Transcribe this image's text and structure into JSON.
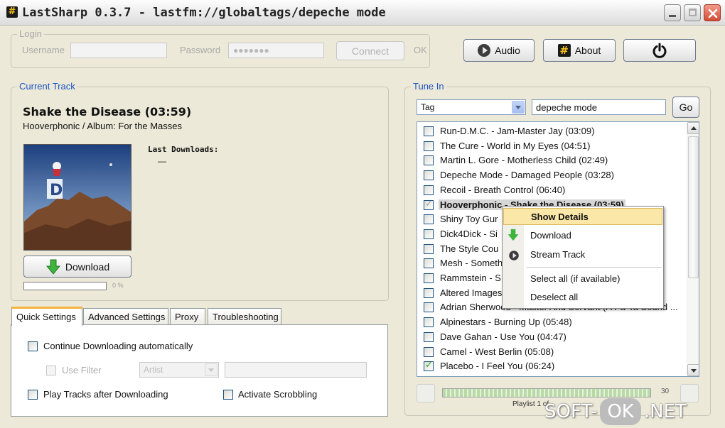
{
  "window": {
    "title": "LastSharp 0.3.7 - lastfm://globaltags/depeche mode",
    "app_icon": "#"
  },
  "login": {
    "legend": "Login",
    "username_label": "Username",
    "username_value": "",
    "password_label": "Password",
    "password_value": "●●●●●●●",
    "connect_label": "Connect",
    "status": "OK"
  },
  "toolbar": {
    "audio_label": "Audio",
    "about_label": "About",
    "power_icon": "power-icon"
  },
  "current_track": {
    "legend": "Current Track",
    "title": "Shake the Disease (03:59)",
    "subtitle": "Hooverphonic / Album: For the Masses",
    "last_downloads_label": "Last Downloads:",
    "last_downloads_value": "—",
    "download_label": "Download",
    "progress_pct": "0 %",
    "progress_value": 0
  },
  "tabs": [
    "Quick Settings",
    "Advanced Settings",
    "Proxy",
    "Troubleshooting"
  ],
  "quick_settings": {
    "continue_label": "Continue Downloading automatically",
    "use_filter_label": "Use Filter",
    "filter_select": "Artist",
    "play_tracks_label": "Play Tracks after Downloading",
    "scrobbling_label": "Activate Scrobbling"
  },
  "tune_in": {
    "legend": "Tune In",
    "type_select": "Tag",
    "query": "depeche mode",
    "go_label": "Go",
    "tracks": [
      {
        "text": "Run-D.M.C. - Jam-Master Jay (03:09)",
        "checked": false
      },
      {
        "text": "The Cure - World in My Eyes (04:51)",
        "checked": false
      },
      {
        "text": "Martin L. Gore - Motherless Child (02:49)",
        "checked": false
      },
      {
        "text": "Depeche Mode - Damaged People (03:28)",
        "checked": false
      },
      {
        "text": "Recoil - Breath Control (06:40)",
        "checked": false
      },
      {
        "text": "Hooverphonic - Shake the Disease (03:59)",
        "checked": true,
        "selected": true
      },
      {
        "text": "Shiny Toy Gur",
        "checked": false
      },
      {
        "text": "Dick4Dick - Si",
        "checked": false
      },
      {
        "text": "The Style Cou",
        "checked": false
      },
      {
        "text": "Mesh - Someth",
        "checked": false
      },
      {
        "text": "Rammstein - S",
        "checked": false
      },
      {
        "text": "Altered Images",
        "checked": false
      },
      {
        "text": "Adrian Sherwood - Master And Servant (A Pa-Ta Sound ...",
        "checked": false
      },
      {
        "text": "Alpinestars - Burning Up (05:48)",
        "checked": false
      },
      {
        "text": "Dave Gahan - Use You (04:47)",
        "checked": false
      },
      {
        "text": "Camel - West Berlin (05:08)",
        "checked": false
      },
      {
        "text": "Placebo - I Feel You (06:24)",
        "checked": true
      }
    ]
  },
  "context_menu": {
    "show_details": "Show Details",
    "download": "Download",
    "stream_track": "Stream Track",
    "select_all": "Select all (if available)",
    "deselect_all": "Deselect all"
  },
  "playlist": {
    "count": "30",
    "label": "Playlist 1 of"
  },
  "watermark": {
    "left": "SOFT-",
    "ok": "OK",
    "right": ".NET"
  },
  "colors": {
    "accent_blue": "#1c54c4",
    "tab_active": "#f5b23d",
    "menu_highlight": "#fbe7a8",
    "download_green": "#3eb33e",
    "close_red": "#d24b34"
  }
}
